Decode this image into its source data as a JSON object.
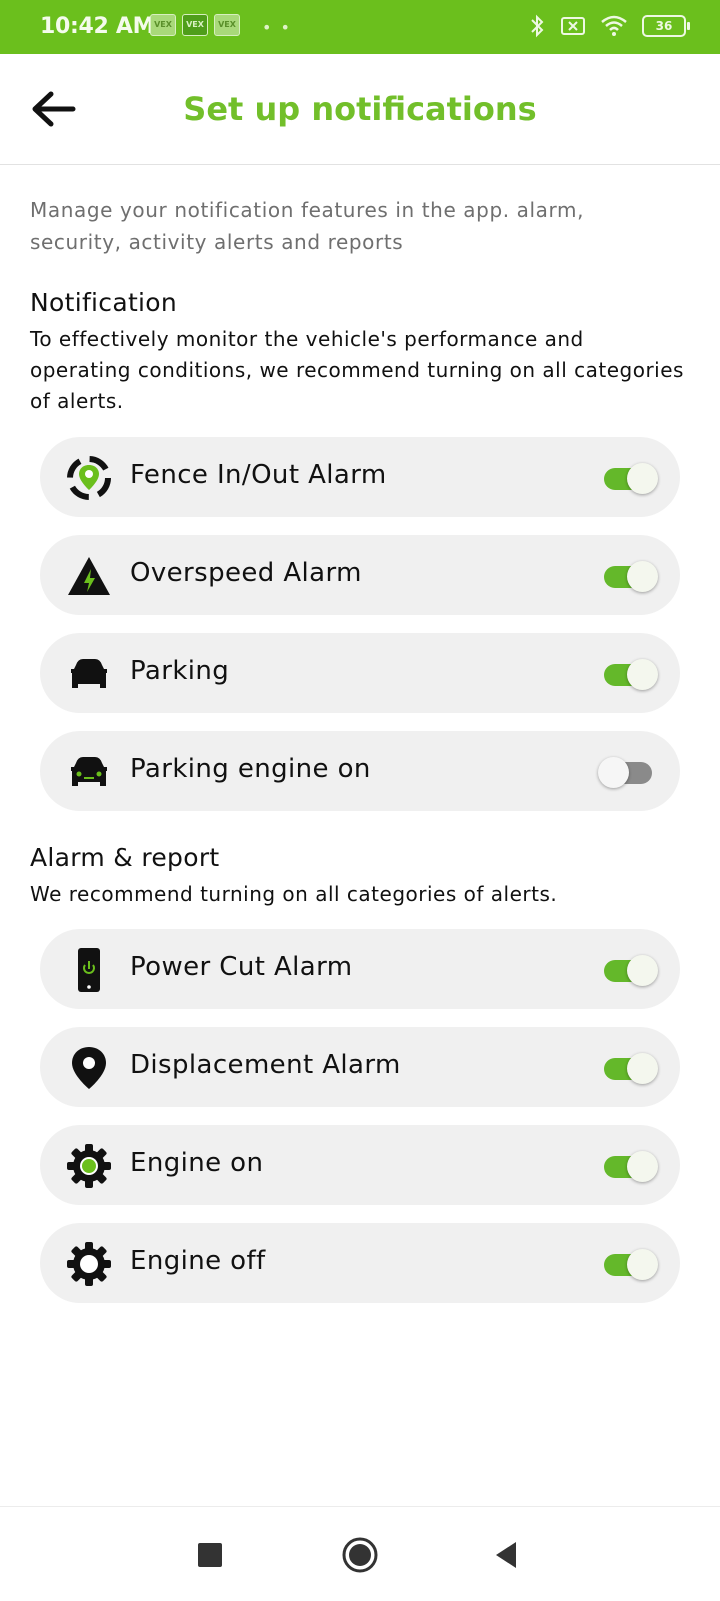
{
  "status_bar": {
    "time": "10:42 AM",
    "app_icons": [
      "VEX",
      "VEX",
      "VEX"
    ],
    "dots": "• •",
    "battery": "36",
    "icons": [
      "bluetooth-icon",
      "sim-off-icon",
      "wifi-icon",
      "battery-icon"
    ]
  },
  "header": {
    "title": "Set up notifications",
    "back_icon": "arrow-left-icon"
  },
  "intro": "Manage your notification features in the app. alarm, security, activity alerts and reports",
  "notification_section": {
    "title": "Notification",
    "description": "To effectively monitor the vehicle's performance and operating conditions, we recommend turning on all categories of alerts.",
    "items": [
      {
        "label": "Fence In/Out Alarm",
        "icon": "geofence-icon",
        "enabled": true
      },
      {
        "label": "Overspeed Alarm",
        "icon": "overspeed-warning-icon",
        "enabled": true
      },
      {
        "label": "Parking",
        "icon": "car-icon",
        "enabled": true
      },
      {
        "label": "Parking engine on",
        "icon": "car-engine-on-icon",
        "enabled": false
      }
    ]
  },
  "alarm_section": {
    "title": "Alarm & report",
    "description": "We recommend turning on all categories of alerts.",
    "items": [
      {
        "label": "Power Cut Alarm",
        "icon": "phone-power-icon",
        "enabled": true
      },
      {
        "label": "Displacement Alarm",
        "icon": "location-pin-icon",
        "enabled": true
      },
      {
        "label": "Engine on",
        "icon": "gear-active-icon",
        "enabled": true
      },
      {
        "label": "Engine off",
        "icon": "gear-icon",
        "enabled": true
      }
    ]
  },
  "colors": {
    "brand_green": "#72bf2a",
    "status_bar": "#6bbf1d",
    "toggle_on": "#64b82a",
    "toggle_off": "#8a8a8a",
    "row_background": "#f0f0f0"
  },
  "nav_bar": {
    "icons": [
      "recent-apps-icon",
      "home-icon",
      "back-icon"
    ]
  }
}
